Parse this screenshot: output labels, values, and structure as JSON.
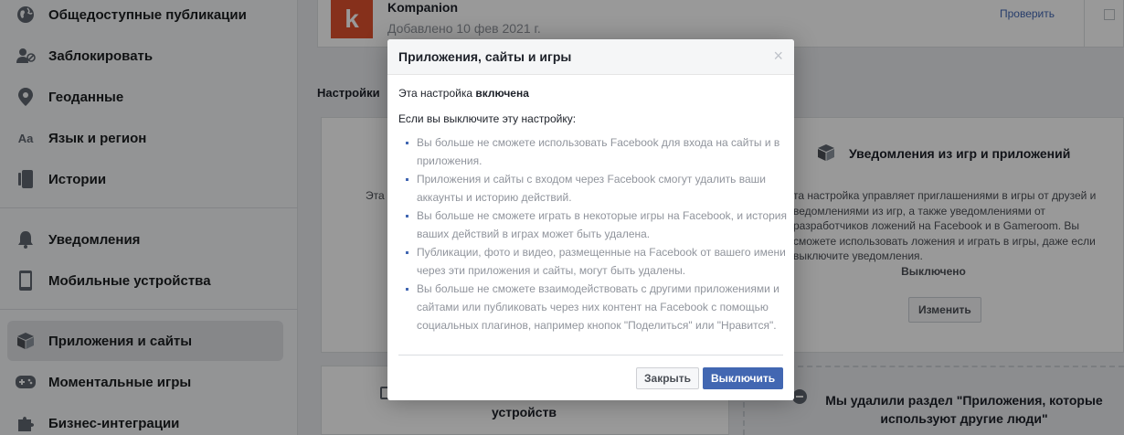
{
  "sidebar": {
    "items": [
      {
        "label": "Общедоступные публикации",
        "icon": "globe-icon"
      },
      {
        "label": "Заблокировать",
        "icon": "block-user-icon"
      },
      {
        "label": "Геоданные",
        "icon": "location-pin-icon"
      },
      {
        "label": "Язык и регион",
        "icon": "language-icon"
      },
      {
        "label": "Истории",
        "icon": "stories-icon"
      },
      {
        "label": "Уведомления",
        "icon": "bell-icon"
      },
      {
        "label": "Мобильные устройства",
        "icon": "mobile-icon"
      },
      {
        "label": "Приложения и сайты",
        "icon": "cube-icon",
        "active": true
      },
      {
        "label": "Моментальные игры",
        "icon": "gamepad-icon"
      },
      {
        "label": "Бизнес-интеграции",
        "icon": "puzzle-icon"
      }
    ],
    "language_icon_text": "Aa"
  },
  "app_card": {
    "logo_letter": "k",
    "name": "Kompanion",
    "added": "Добавлено 10 фев 2021 г.",
    "check_link": "Проверить"
  },
  "settings": {
    "heading": "Настройки",
    "left_snippet": "Эта",
    "right_panel": {
      "title": "Уведомления из игр и приложений",
      "description": "та настройка управляет приглашениями в игры от друзей и ведомлениями из игр, а также уведомлениями от разработчиков ложений на Facebook и в Gameroom. Вы сможете использовать ложения и играть в игры, даже если выключите уведомления.",
      "status": "Выключено",
      "button": "Изменить"
    },
    "bottom_left_text": "устройств",
    "bottom_right_text": "Мы удалили раздел \"Приложения, которые используют другие люди\""
  },
  "dialog": {
    "title": "Приложения, сайты и игры",
    "close_glyph": "×",
    "status_prefix": "Эта настройка",
    "status_value": "включена",
    "intro": "Если вы выключите эту настройку:",
    "bullets": [
      "Вы больше не сможете использовать Facebook для входа на сайты и в приложения.",
      "Приложения и сайты с входом через Facebook смогут удалить ваши аккаунты и историю действий.",
      "Вы больше не сможете играть в некоторые игры на Facebook, и история ваших действий в играх может быть удалена.",
      "Публикации, фото и видео, размещенные на Facebook от вашего имени через эти приложения и сайты, могут быть удалены.",
      "Вы больше не сможете взаимодействовать с другими приложениями и сайтами или публиковать через них контент на Facebook с помощью социальных плагинов, например кнопок \"Поделиться\" или \"Нравится\"."
    ],
    "close_button": "Закрыть",
    "turn_off_button": "Выключить"
  },
  "colors": {
    "primary": "#4267b2",
    "logo_bg": "#e0502e",
    "sidebar_bg": "#f6f7f9"
  }
}
